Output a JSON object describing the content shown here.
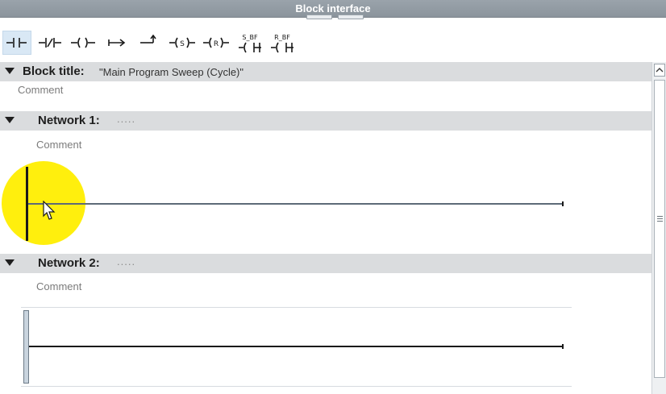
{
  "interface_bar": {
    "title": "Block interface"
  },
  "toolbar": {
    "items": [
      {
        "icon": "normally-open-contact-icon"
      },
      {
        "icon": "normally-closed-contact-icon"
      },
      {
        "icon": "output-coil-icon"
      },
      {
        "icon": "empty-box-icon"
      },
      {
        "icon": "open-branch-icon"
      },
      {
        "icon": "set-coil-icon",
        "text": "S"
      },
      {
        "icon": "reset-coil-icon",
        "text": "R"
      },
      {
        "icon": "set-bit-field-icon",
        "text": "S_BF"
      },
      {
        "icon": "reset-bit-field-icon",
        "text": "R_BF"
      }
    ]
  },
  "block": {
    "label": "Block title:",
    "value": "\"Main Program Sweep (Cycle)\"",
    "comment": "Comment"
  },
  "networks": [
    {
      "label": "Network 1:",
      "title": ".....",
      "comment": "Comment"
    },
    {
      "label": "Network 2:",
      "title": ".....",
      "comment": "Comment"
    }
  ],
  "colors": {
    "header_bg": "#dadcde",
    "highlight": "#ffee00",
    "title_bar": "#9aa3ab"
  }
}
